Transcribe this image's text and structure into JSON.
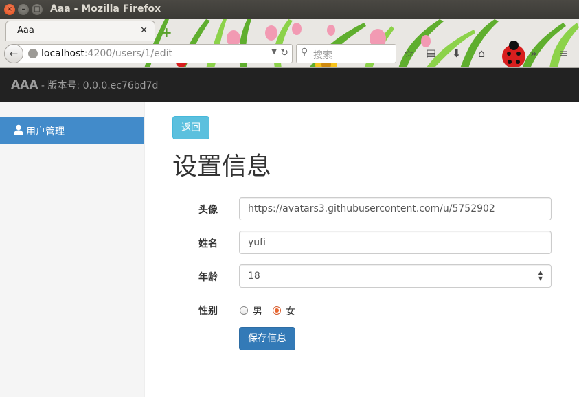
{
  "window": {
    "title": "Aaa - Mozilla Firefox"
  },
  "browser": {
    "tab_title": "Aaa",
    "url_host": "localhost",
    "url_path": ":4200/users/1/edit",
    "search_placeholder": "搜索"
  },
  "app": {
    "brand": "AAA",
    "version": " - 版本号: 0.0.0.ec76bd7d"
  },
  "sidebar": {
    "items": [
      {
        "label": "用户管理",
        "icon": "user-icon",
        "active": true
      }
    ]
  },
  "main": {
    "back_button": "返回",
    "title": "设置信息",
    "fields": {
      "avatar": {
        "label": "头像",
        "value": "https://avatars3.githubusercontent.com/u/5752902"
      },
      "name": {
        "label": "姓名",
        "value": "yufi"
      },
      "age": {
        "label": "年龄",
        "value": "18"
      },
      "gender": {
        "label": "性别",
        "options": [
          "男",
          "女"
        ],
        "selected": "女"
      }
    },
    "save_button": "保存信息"
  },
  "colors": {
    "navbar": "#222222",
    "sidebar_active": "#428bca",
    "info_button": "#5bc0de",
    "primary_button": "#337ab7"
  }
}
